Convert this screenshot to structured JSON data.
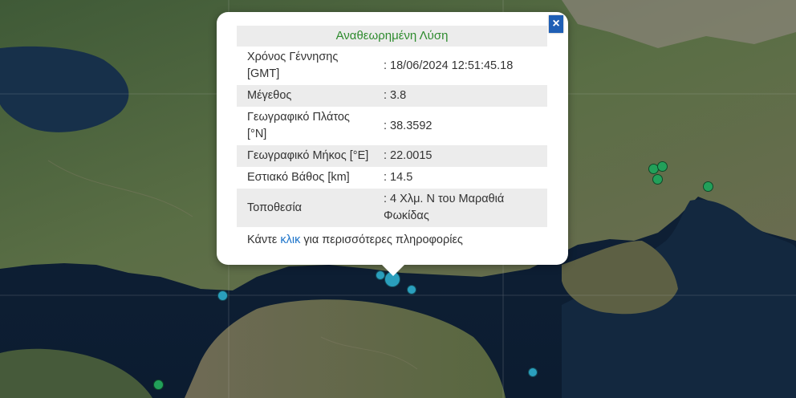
{
  "popup": {
    "title": "Αναθεωρημένη Λύση",
    "rows": [
      {
        "label": "Χρόνος Γέννησης [GMT]",
        "value": ": 18/06/2024 12:51:45.18"
      },
      {
        "label": "Μέγεθος",
        "value": ": 3.8"
      },
      {
        "label": "Γεωγραφικό Πλάτος [°N]",
        "value": ": 38.3592"
      },
      {
        "label": "Γεωγραφικό Μήκος [°E]",
        "value": ": 22.0015"
      },
      {
        "label": "Εστιακό Βάθος [km]",
        "value": ": 14.5"
      },
      {
        "label": "Τοποθεσία",
        "value": ": 4 Χλμ. Ν του Μαραθιά Φωκίδας"
      }
    ],
    "footer": {
      "prefix": "Κάντε ",
      "link": "κλικ",
      "suffix": " για περισσότερες πληροφορίες"
    },
    "close_symbol": "×"
  },
  "colors": {
    "marker_recent": "#2a9fbd",
    "marker_older": "#22a05a",
    "title_green": "#2e8b2e",
    "link_blue": "#1a72c9",
    "close_button": "#1f5fb5"
  },
  "icons": {
    "close": "close-icon",
    "event_markers": "earthquake-marker"
  }
}
